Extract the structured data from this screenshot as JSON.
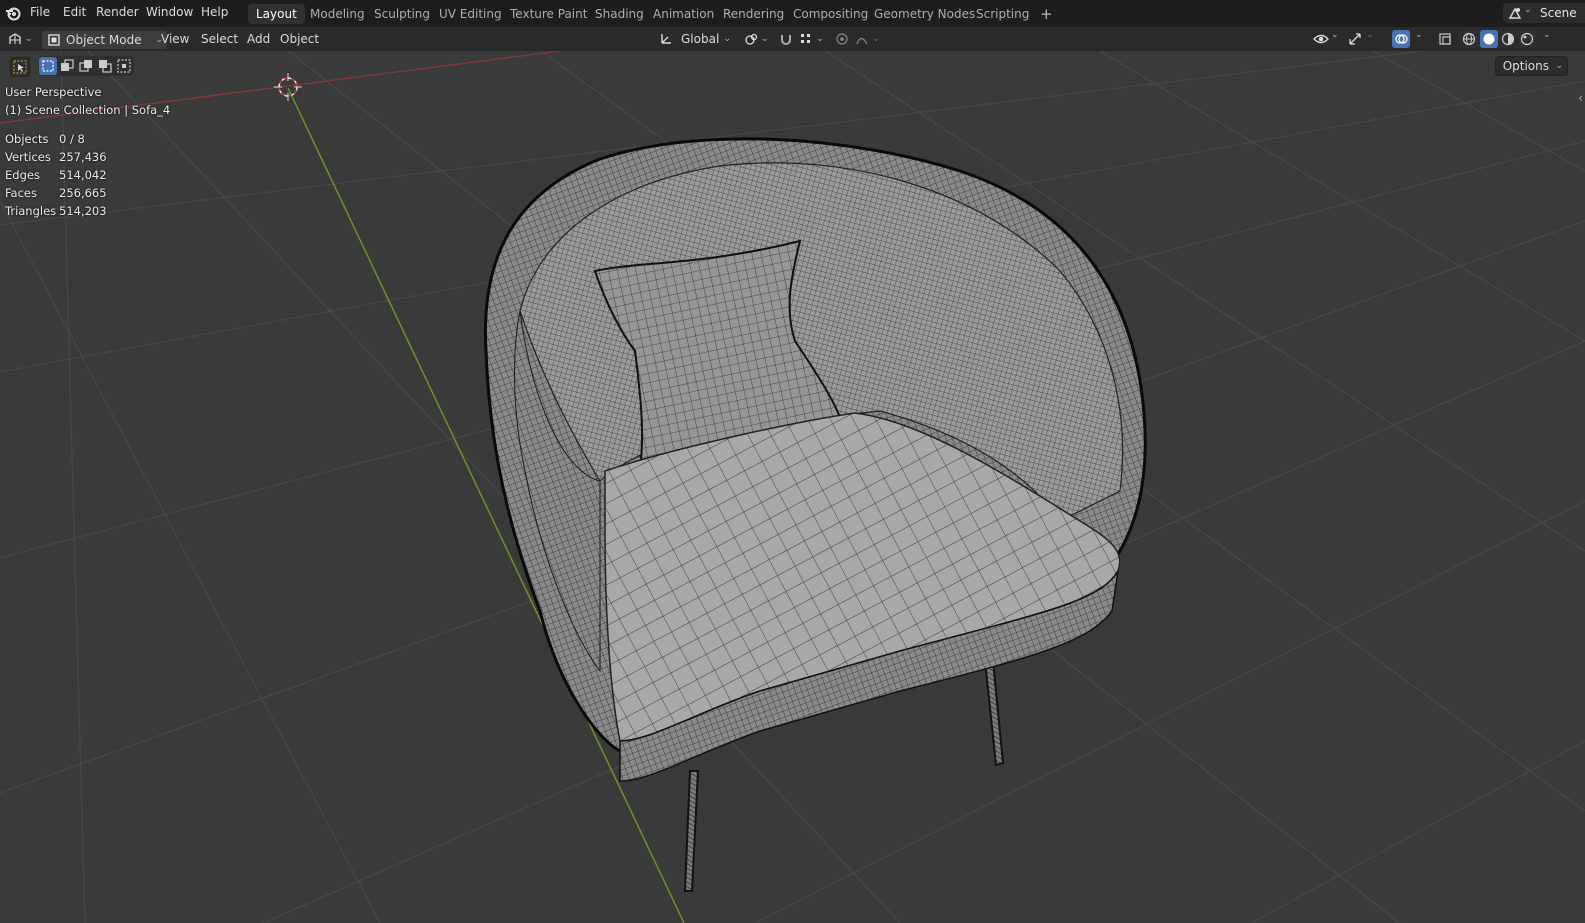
{
  "app": {
    "menu": [
      "File",
      "Edit",
      "Render",
      "Window",
      "Help"
    ],
    "workspaces": [
      "Layout",
      "Modeling",
      "Sculpting",
      "UV Editing",
      "Texture Paint",
      "Shading",
      "Animation",
      "Rendering",
      "Compositing",
      "Geometry Nodes",
      "Scripting"
    ],
    "active_workspace": "Layout",
    "add_workspace": "+",
    "scene_label": "Scene"
  },
  "header": {
    "mode": "Object Mode",
    "menus": [
      "View",
      "Select",
      "Add",
      "Object"
    ],
    "transform_orientation": "Global",
    "options_label": "Options"
  },
  "viewport": {
    "view_name": "User Perspective",
    "collection": "(1) Scene Collection | Sofa_4",
    "stats": [
      {
        "label": "Objects",
        "value": "0 / 8"
      },
      {
        "label": "Vertices",
        "value": "257,436"
      },
      {
        "label": "Edges",
        "value": "514,042"
      },
      {
        "label": "Faces",
        "value": "256,665"
      },
      {
        "label": "Triangles",
        "value": "514,203"
      }
    ]
  },
  "colors": {
    "accent": "#4772b3",
    "x_axis": "#9c3c3c",
    "y_axis": "#6e9a2c",
    "grid": "#4a4a4a",
    "viewport_bg": "#3a3a3a"
  }
}
